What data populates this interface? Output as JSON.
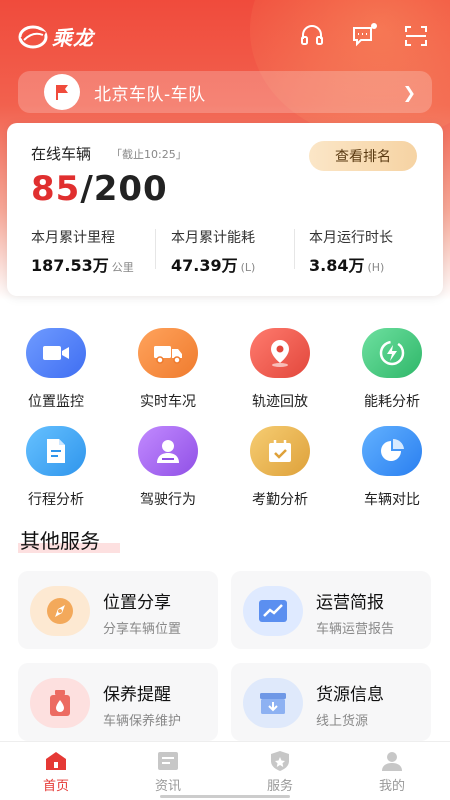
{
  "app": {
    "name": "乘龙"
  },
  "header": {
    "icons": [
      "headset-icon",
      "message-icon",
      "scan-icon"
    ],
    "fleet_name": "北京车队-车队"
  },
  "stats": {
    "online_label": "在线车辆",
    "deadline": "「截止10:25」",
    "rank_button": "查看排名",
    "online_current": "85",
    "online_total": "/200",
    "metrics": [
      {
        "label": "本月累计里程",
        "value": "187.53万",
        "unit": "公里"
      },
      {
        "label": "本月累计能耗",
        "value": "47.39万",
        "unit": "(L)"
      },
      {
        "label": "本月运行时长",
        "value": "3.84万",
        "unit": "(H)"
      }
    ]
  },
  "functions": [
    {
      "label": "位置监控",
      "icon": "video-icon",
      "color": "#4b7bf5"
    },
    {
      "label": "实时车况",
      "icon": "truck-icon",
      "color": "#f08a3c"
    },
    {
      "label": "轨迹回放",
      "icon": "map-pin-icon",
      "color": "#ec5a4e"
    },
    {
      "label": "能耗分析",
      "icon": "energy-icon",
      "color": "#3ec47a"
    },
    {
      "label": "行程分析",
      "icon": "document-icon",
      "color": "#3aa0f0"
    },
    {
      "label": "驾驶行为",
      "icon": "driver-icon",
      "color": "#a25ee8"
    },
    {
      "label": "考勤分析",
      "icon": "calendar-check-icon",
      "color": "#e8b13c"
    },
    {
      "label": "车辆对比",
      "icon": "pie-chart-icon",
      "color": "#3a8ff0"
    }
  ],
  "other_services": {
    "title": "其他服务",
    "items": [
      {
        "title": "位置分享",
        "subtitle": "分享车辆位置",
        "icon": "compass-icon"
      },
      {
        "title": "运营简报",
        "subtitle": "车辆运营报告",
        "icon": "trend-chart-icon"
      },
      {
        "title": "保养提醒",
        "subtitle": "车辆保养维护",
        "icon": "oil-can-icon"
      },
      {
        "title": "货源信息",
        "subtitle": "线上货源",
        "icon": "cargo-box-icon"
      }
    ]
  },
  "tabs": [
    {
      "label": "首页",
      "icon": "home-icon",
      "active": true
    },
    {
      "label": "资讯",
      "icon": "news-icon",
      "active": false
    },
    {
      "label": "服务",
      "icon": "service-shield-icon",
      "active": false
    },
    {
      "label": "我的",
      "icon": "profile-icon",
      "active": false
    }
  ],
  "colors": {
    "brand_red": "#f04b3c",
    "accent_red": "#e02f2f",
    "gold_button": "#f6d3a3"
  }
}
